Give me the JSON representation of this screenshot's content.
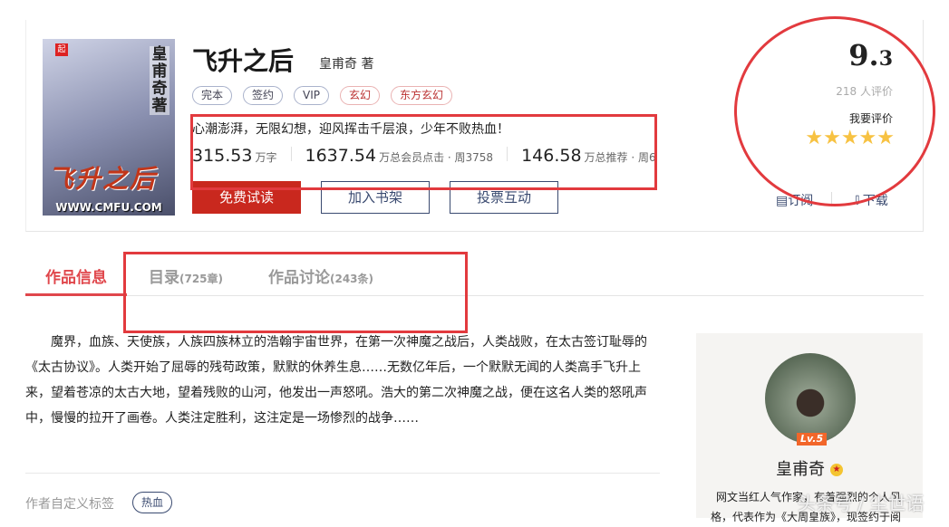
{
  "book": {
    "cover": {
      "logo": "起",
      "author_vertical": "皇甫奇著",
      "title_art": "飞升之后",
      "url": "WWW.CMFU.COM"
    },
    "title": "飞升之后",
    "author": "皇甫奇 著",
    "tags": [
      {
        "label": "完本"
      },
      {
        "label": "签约"
      },
      {
        "label": "VIP"
      },
      {
        "label": "玄幻"
      },
      {
        "label": "东方玄幻"
      }
    ],
    "slogan": "心潮澎湃，无限幻想，迎风挥击千层浪，少年不败热血！",
    "stats": [
      {
        "n": "315.53",
        "u": "万字"
      },
      {
        "n": "1637.54",
        "u": "万总会员点击 · 周3758"
      },
      {
        "n": "146.58",
        "u": "万总推荐 · 周6"
      }
    ],
    "buttons": {
      "read": "免费试读",
      "shelf": "加入书架",
      "vote": "投票互动"
    }
  },
  "rating": {
    "score_int": "9.",
    "score_dec": "3",
    "count": "218 人评价",
    "rate_label": "我要评价",
    "stars": 5,
    "subscribe": "订阅",
    "download": "下载"
  },
  "tabs": [
    {
      "label": "作品信息",
      "count": ""
    },
    {
      "label": "目录",
      "count": "(725章)"
    },
    {
      "label": "作品讨论",
      "count": "(243条)"
    }
  ],
  "description": "魔界，血族、天使族，人族四族林立的浩翰宇宙世界，在第一次神魔之战后，人类战败，在太古签订耻辱的《太古协议》。人类开始了屈辱的残苟政策，默默的休养生息……无数亿年后，一个默默无闻的人类高手飞升上来，望着苍凉的太古大地，望着残败的山河，他发出一声怒吼。浩大的第二次神魔之战，便在这名人类的怒吼声中，慢慢的拉开了画卷。人类注定胜利，这注定是一场惨烈的战争……",
  "custom_tags": {
    "label": "作者自定义标签",
    "tags": [
      "热血"
    ]
  },
  "author_card": {
    "level": "Lv.5",
    "name": "皇甫奇",
    "bio": "网文当红人气作家，有着强烈的个人风格，代表作为《大周皇族》，现签约于阅"
  },
  "watermark": "头条号 / 尘世语"
}
